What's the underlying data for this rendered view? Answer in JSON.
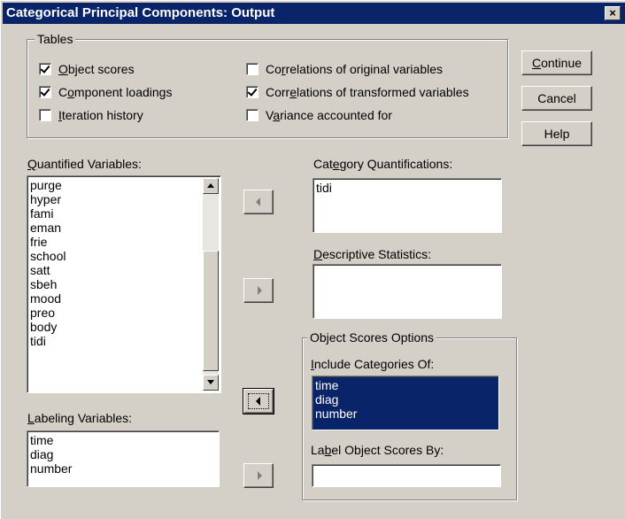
{
  "window": {
    "title": "Categorical Principal Components: Output",
    "close": "×"
  },
  "tables": {
    "legend": "Tables",
    "options": [
      {
        "pre": "",
        "acc": "O",
        "post": "bject scores",
        "checked": true
      },
      {
        "pre": "C",
        "acc": "o",
        "post": "mponent loadings",
        "checked": true
      },
      {
        "pre": "",
        "acc": "I",
        "post": "teration history",
        "checked": false
      },
      {
        "pre": "Co",
        "acc": "r",
        "post": "relations of original variables",
        "checked": false
      },
      {
        "pre": "Corr",
        "acc": "e",
        "post": "lations of transformed variables",
        "checked": true
      },
      {
        "pre": "V",
        "acc": "a",
        "post": "riance accounted for",
        "checked": false
      }
    ]
  },
  "buttons": {
    "continue_acc": "C",
    "continue_rest": "ontinue",
    "cancel": "Cancel",
    "help": "Help"
  },
  "quantified": {
    "label_acc": "Q",
    "label_rest": "uantified Variables:",
    "items": [
      "purge",
      "hyper",
      "fami",
      "eman",
      "frie",
      "school",
      "satt",
      "sbeh",
      "mood",
      "preo",
      "body",
      "tidi"
    ]
  },
  "labeling": {
    "label_acc": "L",
    "label_rest": "abeling Variables:",
    "items": [
      "time",
      "diag",
      "number"
    ]
  },
  "category_quant": {
    "label_pre": "Cat",
    "label_acc": "e",
    "label_rest": "gory Quantifications:",
    "items": [
      "tidi"
    ]
  },
  "descriptive": {
    "label_acc": "D",
    "label_rest": "escriptive Statistics:",
    "items": []
  },
  "object_scores_options": {
    "legend": "Object Scores Options",
    "include_acc": "I",
    "include_rest": "nclude Categories Of:",
    "include_items": [
      "time",
      "diag",
      "number"
    ],
    "label_by_pre": "La",
    "label_by_acc": "b",
    "label_by_rest": "el Object Scores By:",
    "label_by_value": ""
  },
  "colors": {
    "selection": "#0a246a",
    "face": "#d4d0c8",
    "title": "#0a246a"
  }
}
